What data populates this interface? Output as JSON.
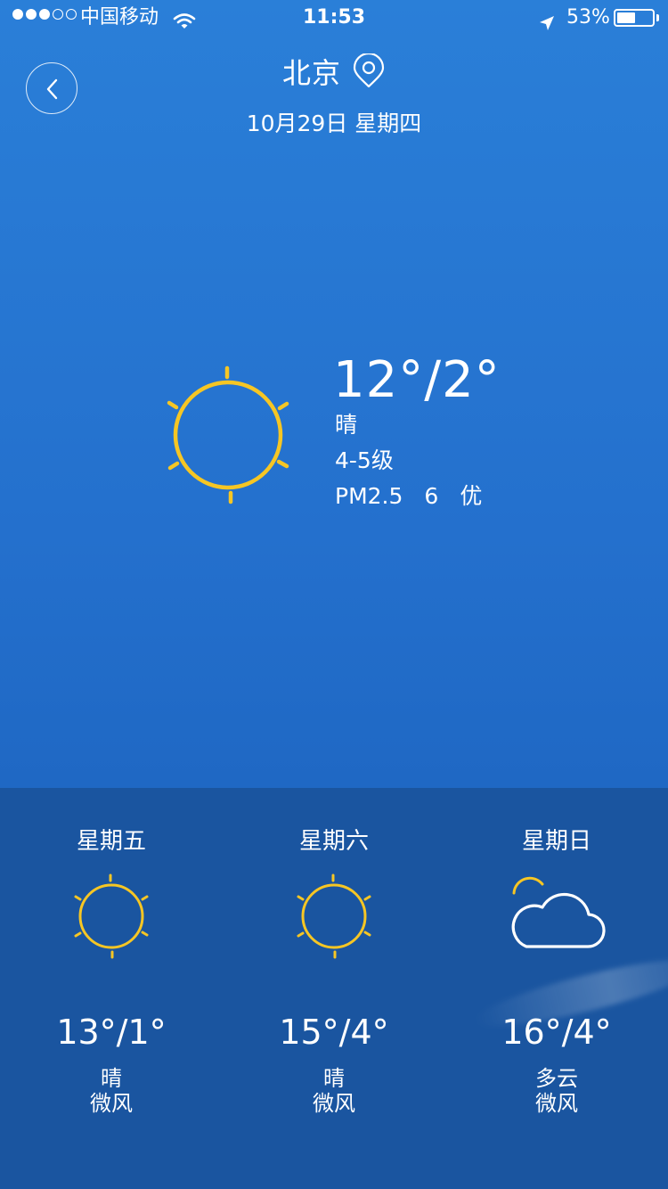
{
  "status": {
    "carrier": "中国移动",
    "time": "11:53",
    "battery": "53%",
    "battery_level": 0.53,
    "signal_bars": 3
  },
  "header": {
    "city": "北京",
    "date": "10月29日 星期四"
  },
  "current": {
    "temp": "12°/2°",
    "condition": "晴",
    "wind": "4-5级",
    "aqi_label": "PM2.5",
    "aqi_value": "6",
    "aqi_level": "优",
    "icon": "sun-icon"
  },
  "forecast": [
    {
      "day": "星期五",
      "temp": "13°/1°",
      "condition": "晴",
      "wind": "微风",
      "icon": "sun-icon"
    },
    {
      "day": "星期六",
      "temp": "15°/4°",
      "condition": "晴",
      "wind": "微风",
      "icon": "sun-icon"
    },
    {
      "day": "星期日",
      "temp": "16°/4°",
      "condition": "多云",
      "wind": "微风",
      "icon": "partly-cloudy-icon"
    }
  ],
  "colors": {
    "sun": "#f6c624",
    "background_top": "#2a7fd8",
    "panel": "#1a55a0"
  }
}
